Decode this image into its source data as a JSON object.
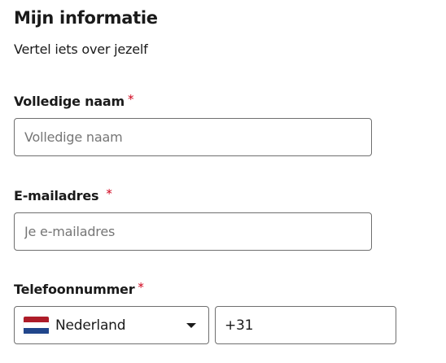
{
  "section": {
    "title": "Mijn informatie",
    "subtitle": "Vertel iets over jezelf"
  },
  "required_marker": "*",
  "fields": {
    "full_name": {
      "label": "Volledige naam",
      "placeholder": "Volledige naam",
      "value": ""
    },
    "email": {
      "label": "E-mailadres",
      "placeholder": "Je e-mailadres",
      "value": ""
    },
    "phone": {
      "label": "Telefoonnummer",
      "country": {
        "name": "Nederland",
        "flag_icon": "flag-netherlands-icon",
        "flag_colors": [
          "#ae1c28",
          "#ffffff",
          "#21468b"
        ]
      },
      "value": "+31"
    }
  },
  "colors": {
    "required": "#d0021b",
    "text": "#1a1a1a",
    "border": "#6f6f6f",
    "placeholder": "#767676"
  }
}
